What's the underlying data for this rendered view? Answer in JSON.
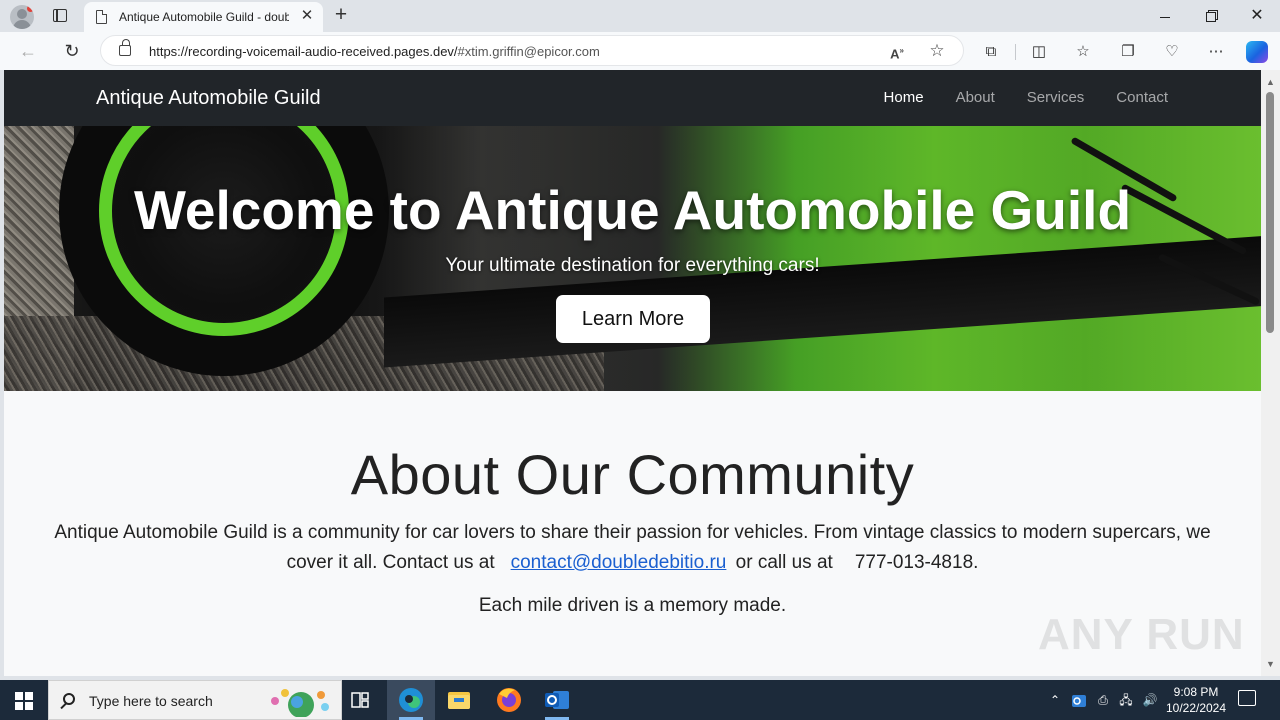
{
  "browser": {
    "tab_title": "Antique Automobile Guild - doubl",
    "tab_close_glyph": "✕",
    "new_tab_glyph": "+",
    "url_host": "https://recording-voicemail-audio-received.pages.dev/",
    "url_fragment": "#xtim.griffin@epicor.com",
    "window_close_glyph": "✕"
  },
  "site": {
    "brand": "Antique Automobile Guild",
    "nav": [
      {
        "label": "Home"
      },
      {
        "label": "About"
      },
      {
        "label": "Services"
      },
      {
        "label": "Contact"
      }
    ],
    "hero": {
      "title": "Welcome to Antique Automobile Guild",
      "subtitle": "Your ultimate destination for everything cars!",
      "button": "Learn More"
    },
    "about": {
      "title": "About Our Community",
      "text_before": "Antique Automobile Guild is a community for car lovers to share their passion for vehicles. From vintage classics to modern supercars, we cover it all. Contact us at",
      "email": "contact@doubledebitio.ru",
      "text_middle": "or call us at",
      "phone": "777-013-4818",
      "text_after": ".",
      "tagline": "Each mile driven is a memory made."
    },
    "watermark": "ANY RUN"
  },
  "taskbar": {
    "search_placeholder": "Type here to search",
    "time": "9:08 PM",
    "date": "10/22/2024"
  },
  "colors": {
    "site_nav_bg": "#212529",
    "link": "#1a5fd0",
    "taskbar_bg": "#1c2a3a"
  }
}
